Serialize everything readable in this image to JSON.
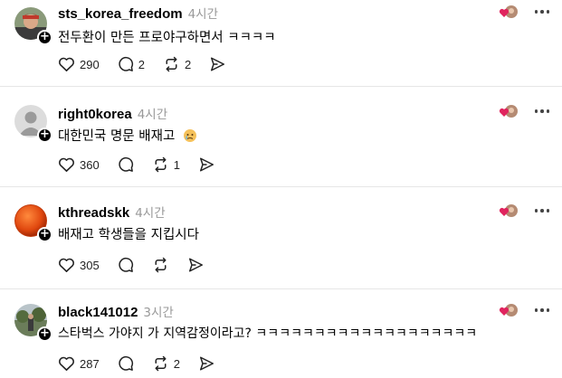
{
  "posts": [
    {
      "username": "sts_korea_freedom",
      "time": "4시간",
      "text": "전두환이 만든 프로야구하면서 ㅋㅋㅋㅋ",
      "likes": "290",
      "comments": "2",
      "reposts": "2",
      "avatar": "person-photo-avatar"
    },
    {
      "username": "right0korea",
      "time": "4시간",
      "text": "대한민국 명문 배재고",
      "likes": "360",
      "comments": "",
      "reposts": "1",
      "avatar": "default-avatar",
      "emoji": "crying-face-emoji"
    },
    {
      "username": "kthreadskk",
      "time": "4시간",
      "text": "배재고 학생들을 지킵시다",
      "likes": "305",
      "comments": "",
      "reposts": "",
      "avatar": "orange-sphere-avatar"
    },
    {
      "username": "black141012",
      "time": "3시간",
      "text": "스타벅스 가야지 가 지역감정이라고? ㅋㅋㅋㅋㅋㅋㅋㅋㅋㅋㅋㅋㅋㅋㅋㅋㅋㅋㅋ",
      "likes": "287",
      "comments": "",
      "reposts": "2",
      "avatar": "outdoor-photo-avatar"
    }
  ],
  "colors": {
    "time": "#999999",
    "divider": "#e6e6e6",
    "heart_badge": "#e0245e"
  }
}
